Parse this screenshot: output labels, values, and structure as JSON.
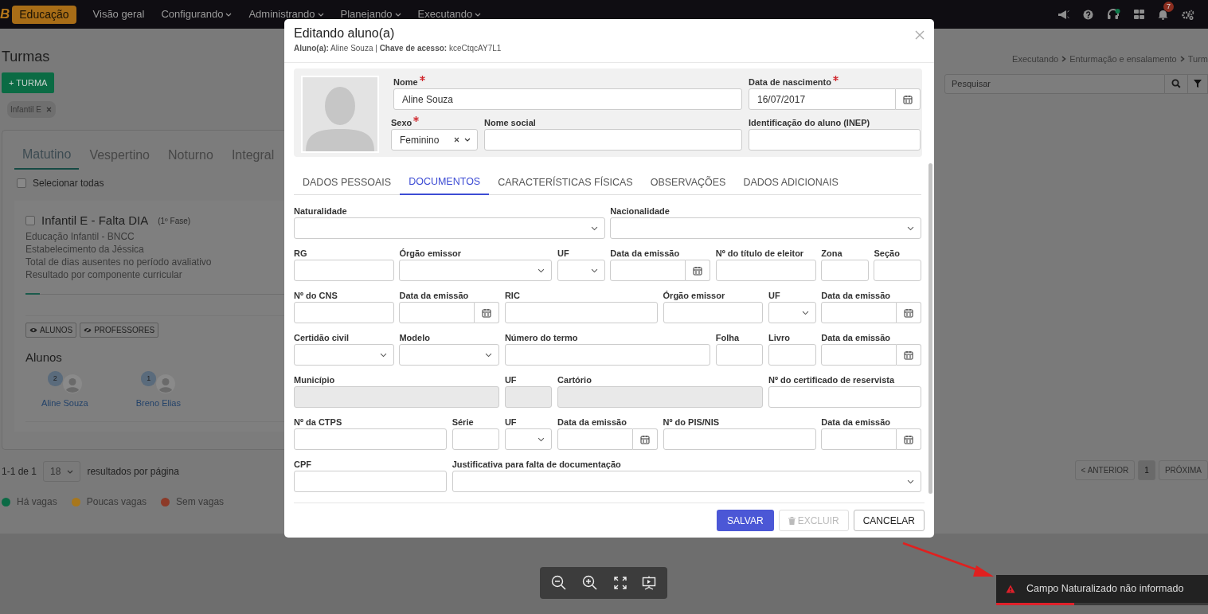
{
  "navbar": {
    "logo": "B",
    "brand": "Educação",
    "menu": [
      {
        "label": "Visão geral",
        "dropdown": false
      },
      {
        "label": "Configurando",
        "dropdown": true
      },
      {
        "label": "Administrando",
        "dropdown": true
      },
      {
        "label": "Planejando",
        "dropdown": true
      },
      {
        "label": "Executando",
        "dropdown": true
      }
    ],
    "notification_count": "7"
  },
  "page": {
    "title": "Turmas",
    "add_button": "+ TURMA",
    "filter_chips": [
      {
        "label": "Infantil E"
      }
    ],
    "shift_tabs": [
      {
        "label": "Matutino",
        "selected": true
      },
      {
        "label": "Vespertino",
        "selected": false
      },
      {
        "label": "Noturno",
        "selected": false
      },
      {
        "label": "Integral",
        "selected": false
      }
    ],
    "select_all": {
      "label": "Selecionar todas",
      "checked": false
    },
    "class_card": {
      "title": "Infantil E - Falta DIA",
      "phase": "(1º Fase)",
      "checked": false,
      "details": [
        "Educação Infantil - BNCC",
        "Estabelecimento da Jéssica",
        "Total de dias ausentes no período avaliativo",
        "Resultado por componente curricular"
      ],
      "buttons": [
        {
          "label": "ALUNOS",
          "kind": "eye"
        },
        {
          "label": "PROFESSORES",
          "kind": "eye-slash"
        }
      ],
      "students_heading": "Alunos",
      "students": [
        {
          "count": "2",
          "name": "Aline Souza"
        },
        {
          "count": "1",
          "name": "Breno Elias"
        }
      ]
    },
    "pagination": {
      "range": "1-1 de 1",
      "per_page": "18",
      "per_page_label": "resultados por página",
      "pages": [
        {
          "label": "< ANTERIOR",
          "selected": false
        },
        {
          "label": "1",
          "selected": true
        },
        {
          "label": "PRÓXIMA",
          "selected": false
        }
      ]
    },
    "legend": [
      {
        "label": "Há vagas",
        "color": "#0b6a45"
      },
      {
        "label": "Poucas vagas",
        "color": "#a8771c"
      },
      {
        "label": "Sem vagas",
        "color": "#8c3a28"
      }
    ],
    "breadcrumb": [
      "Executando",
      "Enturmação e ensalamento",
      "Turm"
    ],
    "search": {
      "placeholder": "Pesquisar"
    }
  },
  "modal": {
    "title": "Editando aluno(a)",
    "subtitle": "**Aluno(a):** Aline Souza | **Chave de acesso:** kceCtqcAY7L1",
    "header_fields": [
      {
        "label": "Nome",
        "required": true,
        "kind": "text",
        "value": "Aline Souza"
      },
      {
        "label": "Data de nascimento",
        "required": true,
        "kind": "date",
        "value": "16/07/2017"
      },
      {
        "label": "Sexo",
        "required": true,
        "kind": "select",
        "value": "Feminino",
        "clearable": true
      },
      {
        "label": "Nome social",
        "required": false,
        "kind": "text"
      },
      {
        "label": "Identificação do aluno (INEP)",
        "required": false,
        "kind": "text"
      }
    ],
    "tabs": [
      {
        "label": "DADOS PESSOAIS",
        "selected": false
      },
      {
        "label": "DOCUMENTOS",
        "selected": true
      },
      {
        "label": "CARACTERÍSTICAS FÍSICAS",
        "selected": false
      },
      {
        "label": "OBSERVAÇÕES",
        "selected": false
      },
      {
        "label": "DADOS ADICIONAIS",
        "selected": false
      }
    ],
    "form_rows": [
      [
        {
          "label": "Naturalidade",
          "kind": "select",
          "disabled": false
        },
        {
          "label": "Nacionalidade",
          "kind": "select",
          "disabled": false
        }
      ],
      [
        {
          "label": "RG",
          "kind": "text",
          "disabled": false
        },
        {
          "label": "Órgão emissor",
          "kind": "select",
          "disabled": false
        },
        {
          "label": "UF",
          "kind": "select",
          "disabled": false
        },
        {
          "label": "Data da emissão",
          "kind": "date",
          "disabled": false
        },
        {
          "label": "Nº do título de eleitor",
          "kind": "text",
          "disabled": false
        },
        {
          "label": "Zona",
          "kind": "text",
          "disabled": false
        },
        {
          "label": "Seção",
          "kind": "text",
          "disabled": false
        }
      ],
      [
        {
          "label": "Nº do CNS",
          "kind": "text",
          "disabled": false
        },
        {
          "label": "Data da emissão",
          "kind": "date",
          "disabled": false
        },
        {
          "label": "RIC",
          "kind": "text",
          "disabled": false
        },
        {
          "label": "Órgão emissor",
          "kind": "text",
          "disabled": false
        },
        {
          "label": "UF",
          "kind": "select",
          "disabled": false
        },
        {
          "label": "Data da emissão",
          "kind": "date",
          "disabled": false
        }
      ],
      [
        {
          "label": "Certidão civil",
          "kind": "select",
          "disabled": false
        },
        {
          "label": "Modelo",
          "kind": "select",
          "disabled": false
        },
        {
          "label": "Número do termo",
          "kind": "text",
          "disabled": false
        },
        {
          "label": "Folha",
          "kind": "text",
          "disabled": false
        },
        {
          "label": "Livro",
          "kind": "text",
          "disabled": false
        },
        {
          "label": "Data da emissão",
          "kind": "date",
          "disabled": false
        }
      ],
      [
        {
          "label": "Município",
          "kind": "text",
          "disabled": true
        },
        {
          "label": "UF",
          "kind": "text",
          "disabled": true
        },
        {
          "label": "Cartório",
          "kind": "text",
          "disabled": true
        },
        {
          "label": "Nº do certificado de reservista",
          "kind": "text",
          "disabled": false
        }
      ],
      [
        {
          "label": "Nº da CTPS",
          "kind": "text",
          "disabled": false
        },
        {
          "label": "Série",
          "kind": "text",
          "disabled": false
        },
        {
          "label": "UF",
          "kind": "select",
          "disabled": false
        },
        {
          "label": "Data da emissão",
          "kind": "date",
          "disabled": false
        },
        {
          "label": "Nº do PIS/NIS",
          "kind": "text",
          "disabled": false
        },
        {
          "label": "Data da emissão",
          "kind": "date",
          "disabled": false
        }
      ],
      [
        {
          "label": "CPF",
          "kind": "text",
          "disabled": false
        },
        {
          "label": "Justificativa para falta de documentação",
          "kind": "select",
          "disabled": false
        }
      ]
    ],
    "buttons": [
      {
        "label": "SALVAR",
        "kind": "primary",
        "disabled": false
      },
      {
        "label": "EXCLUIR",
        "kind": "delete",
        "disabled": true
      },
      {
        "label": "CANCELAR",
        "kind": "secondary",
        "disabled": false
      }
    ]
  },
  "toast": {
    "message": "Campo Naturalizado não informado",
    "level": 0.37
  }
}
